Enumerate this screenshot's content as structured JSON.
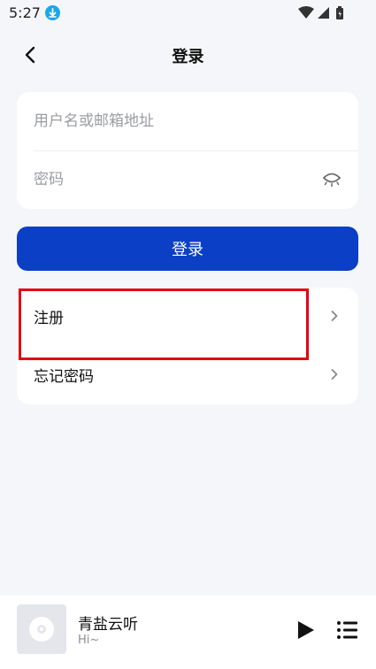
{
  "status": {
    "time": "5:27"
  },
  "nav": {
    "title": "登录"
  },
  "login": {
    "username_placeholder": "用户名或邮箱地址",
    "password_placeholder": "密码",
    "submit_label": "登录"
  },
  "menu": {
    "items": [
      {
        "label": "注册"
      },
      {
        "label": "忘记密码"
      }
    ]
  },
  "player": {
    "title": "青盐云听",
    "subtitle": "Hi~"
  },
  "colors": {
    "primary": "#0a3fc6",
    "highlight": "#e10010",
    "background": "#f5f6f9"
  },
  "icons": [
    "download-icon",
    "wifi-icon",
    "signal-icon",
    "battery-icon",
    "back-arrow-icon",
    "eye-closed-icon",
    "chevron-right-icon",
    "disc-icon",
    "play-icon",
    "playlist-icon"
  ]
}
